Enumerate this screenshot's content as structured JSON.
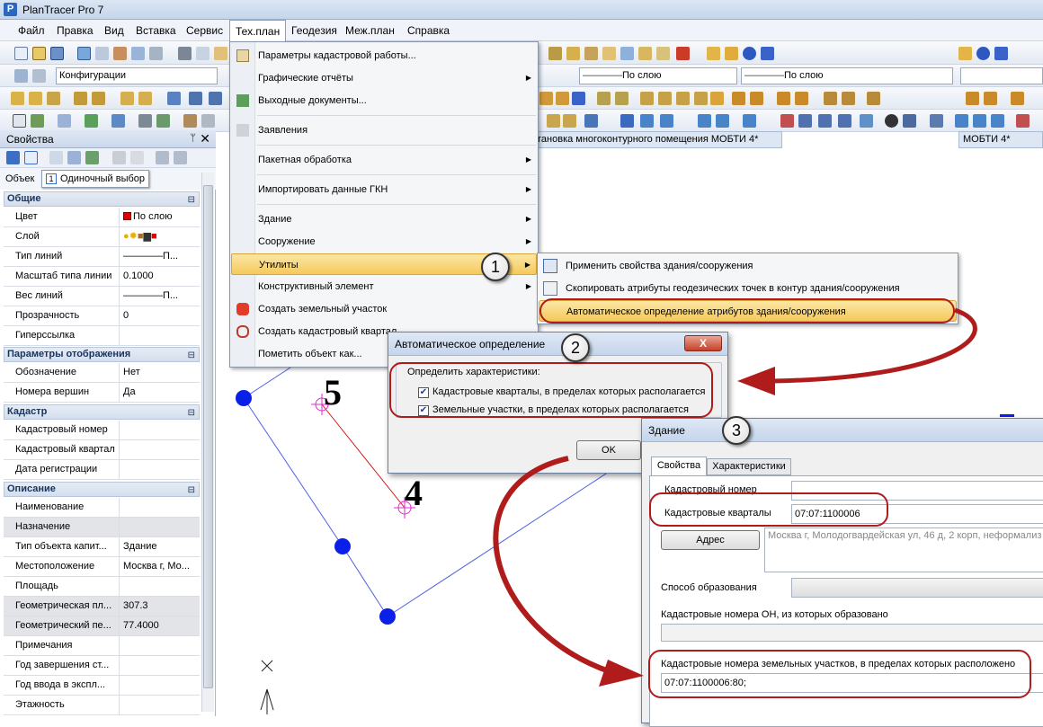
{
  "window": {
    "title": "PlanTracer Pro 7"
  },
  "menubar": [
    "Файл",
    "Правка",
    "Вид",
    "Вставка",
    "Сервис",
    "Тех.план",
    "Геодезия",
    "Меж.план",
    "Справка"
  ],
  "toolbar": {
    "config_combo": "Конфигурации",
    "linetype_combo_1": "По слою",
    "linetype_combo_2": "По слою"
  },
  "tabs": [
    "тановка многоконтурного помещения МОБТИ 4*",
    "МОБТИ 4*"
  ],
  "properties_panel": {
    "title": "Свойства",
    "pin": "ᛘ",
    "close": "✕",
    "object_label": "Объек",
    "tooltip": "Одиночный выбор",
    "sections": [
      {
        "name": "Общие",
        "rows": [
          {
            "k": "Цвет",
            "v": "По слою"
          },
          {
            "k": "Слой",
            "v": ""
          },
          {
            "k": "Тип линий",
            "v": "————П..."
          },
          {
            "k": "Масштаб типа линии",
            "v": "0.1000"
          },
          {
            "k": "Вес линий",
            "v": "————П..."
          },
          {
            "k": "Прозрачность",
            "v": "0"
          },
          {
            "k": "Гиперссылка",
            "v": ""
          }
        ]
      },
      {
        "name": "Параметры отображения",
        "rows": [
          {
            "k": "Обозначение",
            "v": "Нет"
          },
          {
            "k": "Номера вершин",
            "v": "Да"
          }
        ]
      },
      {
        "name": "Кадастр",
        "rows": [
          {
            "k": "Кадастровый номер",
            "v": ""
          },
          {
            "k": "Кадастровый квартал",
            "v": ""
          },
          {
            "k": "Дата регистрации",
            "v": ""
          }
        ]
      },
      {
        "name": "Описание",
        "rows": [
          {
            "k": "Наименование",
            "v": ""
          },
          {
            "k": "Назначение",
            "v": ""
          },
          {
            "k": "Тип объекта капит...",
            "v": "Здание"
          },
          {
            "k": "Местоположение",
            "v": "Москва г, Мо..."
          },
          {
            "k": "Площадь",
            "v": ""
          },
          {
            "k": "Геометрическая пл...",
            "v": "307.3"
          },
          {
            "k": "Геометрический пе...",
            "v": "77.4000"
          },
          {
            "k": "Примечания",
            "v": ""
          },
          {
            "k": "Год завершения ст...",
            "v": ""
          },
          {
            "k": "Год ввода в экспл...",
            "v": ""
          },
          {
            "k": "Этажность",
            "v": ""
          }
        ]
      }
    ]
  },
  "techplan_menu": [
    {
      "label": "Параметры кадастровой работы...",
      "arrow": false
    },
    {
      "label": "Графические отчёты",
      "arrow": true
    },
    {
      "label": "Выходные документы...",
      "arrow": false
    },
    {
      "label": "Заявления",
      "arrow": false
    },
    {
      "label": "Пакетная обработка",
      "arrow": true
    },
    {
      "label": "Импортировать данные ГКН",
      "arrow": true
    },
    {
      "label": "Здание",
      "arrow": true
    },
    {
      "label": "Сооружение",
      "arrow": true
    },
    {
      "label": "Утилиты",
      "arrow": true
    },
    {
      "label": "Конструктивный элемент",
      "arrow": true
    },
    {
      "label": "Создать земельный участок",
      "arrow": false
    },
    {
      "label": "Создать кадастровый квартал",
      "arrow": false
    },
    {
      "label": "Пометить объект как...",
      "arrow": false
    }
  ],
  "submenu": [
    "Применить свойства здания/сооружения",
    "Скопировать атрибуты геодезических точек в контур здания/сооружения",
    "Автоматическое определение атрибутов здания/сооружения"
  ],
  "dialog_auto": {
    "title": "Автоматическое определение",
    "close": "X",
    "group_label": "Определить характеристики:",
    "check1": "Кадастровые кварталы, в пределах которых располагается",
    "check2": "Земельные участки, в пределах которых располагается",
    "ok": "OK"
  },
  "dialog_building": {
    "title": "Здание",
    "tab1": "Свойства",
    "tab2": "Характеристики",
    "cad_number_label": "Кадастровый номер",
    "cad_quarters_label": "Кадастровые кварталы",
    "cad_quarters_value": "07:07:1100006",
    "address_btn": "Адрес",
    "address_value": "Москва г, Молодогвардейская ул, 46 д, 2 корп, неформализ",
    "formation_label": "Способ образования",
    "source_numbers_label": "Кадастровые номера ОН, из которых образовано",
    "land_numbers_label": "Кадастровые номера земельных участков, в пределах которых расположено",
    "land_numbers_value": "07:07:1100006:80;"
  },
  "callouts": [
    "1",
    "2",
    "3"
  ],
  "drawing": {
    "vertex_5": "5",
    "vertex_4": "4"
  },
  "colors": {
    "accent": "#f5c95c",
    "callout_red": "#b01b1b",
    "vertex_blue": "#0a20e8"
  }
}
